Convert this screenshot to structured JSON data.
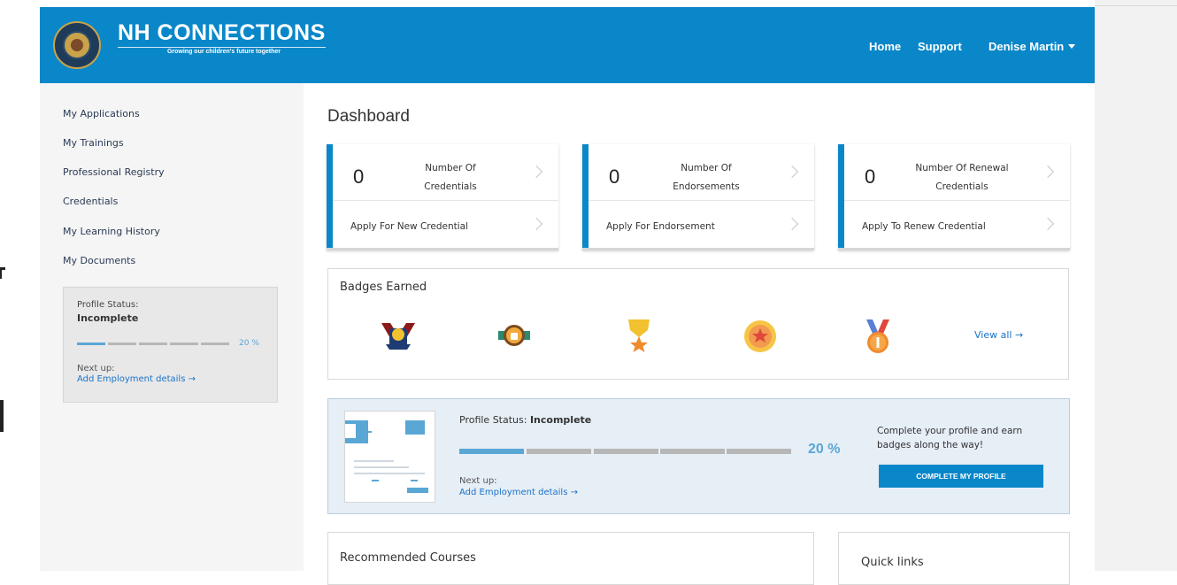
{
  "header": {
    "brand": "NH CONNECTIONS",
    "tagline": "Growing our children's future together",
    "nav": {
      "home": "Home",
      "support": "Support",
      "user": "Denise Martin"
    }
  },
  "sidebar": {
    "items": [
      {
        "label": "My Applications"
      },
      {
        "label": "My Trainings"
      },
      {
        "label": "Professional Registry"
      },
      {
        "label": "Credentials"
      },
      {
        "label": "My Learning History"
      },
      {
        "label": "My Documents"
      }
    ],
    "profile": {
      "label": "Profile Status:",
      "value": "Incomplete",
      "percent_text": "20 %",
      "progress": 0.2,
      "next_label": "Next up:",
      "next_link": "Add Employment details →"
    }
  },
  "main": {
    "title": "Dashboard",
    "stats": [
      {
        "count": "0",
        "label": "Number Of Credentials",
        "action": "Apply For New Credential"
      },
      {
        "count": "0",
        "label": "Number Of Endorsements",
        "action": "Apply For Endorsement"
      },
      {
        "count": "0",
        "label": "Number Of Renewal Credentials",
        "action": "Apply To Renew Credential"
      }
    ],
    "badges": {
      "title": "Badges Earned",
      "items": [
        "shield-badge-icon",
        "thumbs-up-badge-icon",
        "star-medal-icon",
        "star-seal-icon",
        "number-one-medal-icon"
      ],
      "view_all": "View all →"
    },
    "profile_panel": {
      "status_label": "Profile Status:",
      "status_value": "Incomplete",
      "percent_text": "20 %",
      "progress": 0.2,
      "next_label": "Next up:",
      "next_link": "Add Employment details →",
      "cta_text": "Complete your profile and earn badges along the way!",
      "button_label": "COMPLETE MY PROFILE"
    },
    "recommended_title": "Recommended Courses",
    "quick_links_title": "Quick links"
  },
  "colors": {
    "header_blue": "#0a87c9",
    "link_blue": "#1a73c8",
    "progress_blue": "#5aa7d6",
    "progress_gray": "#b7b7b7"
  }
}
